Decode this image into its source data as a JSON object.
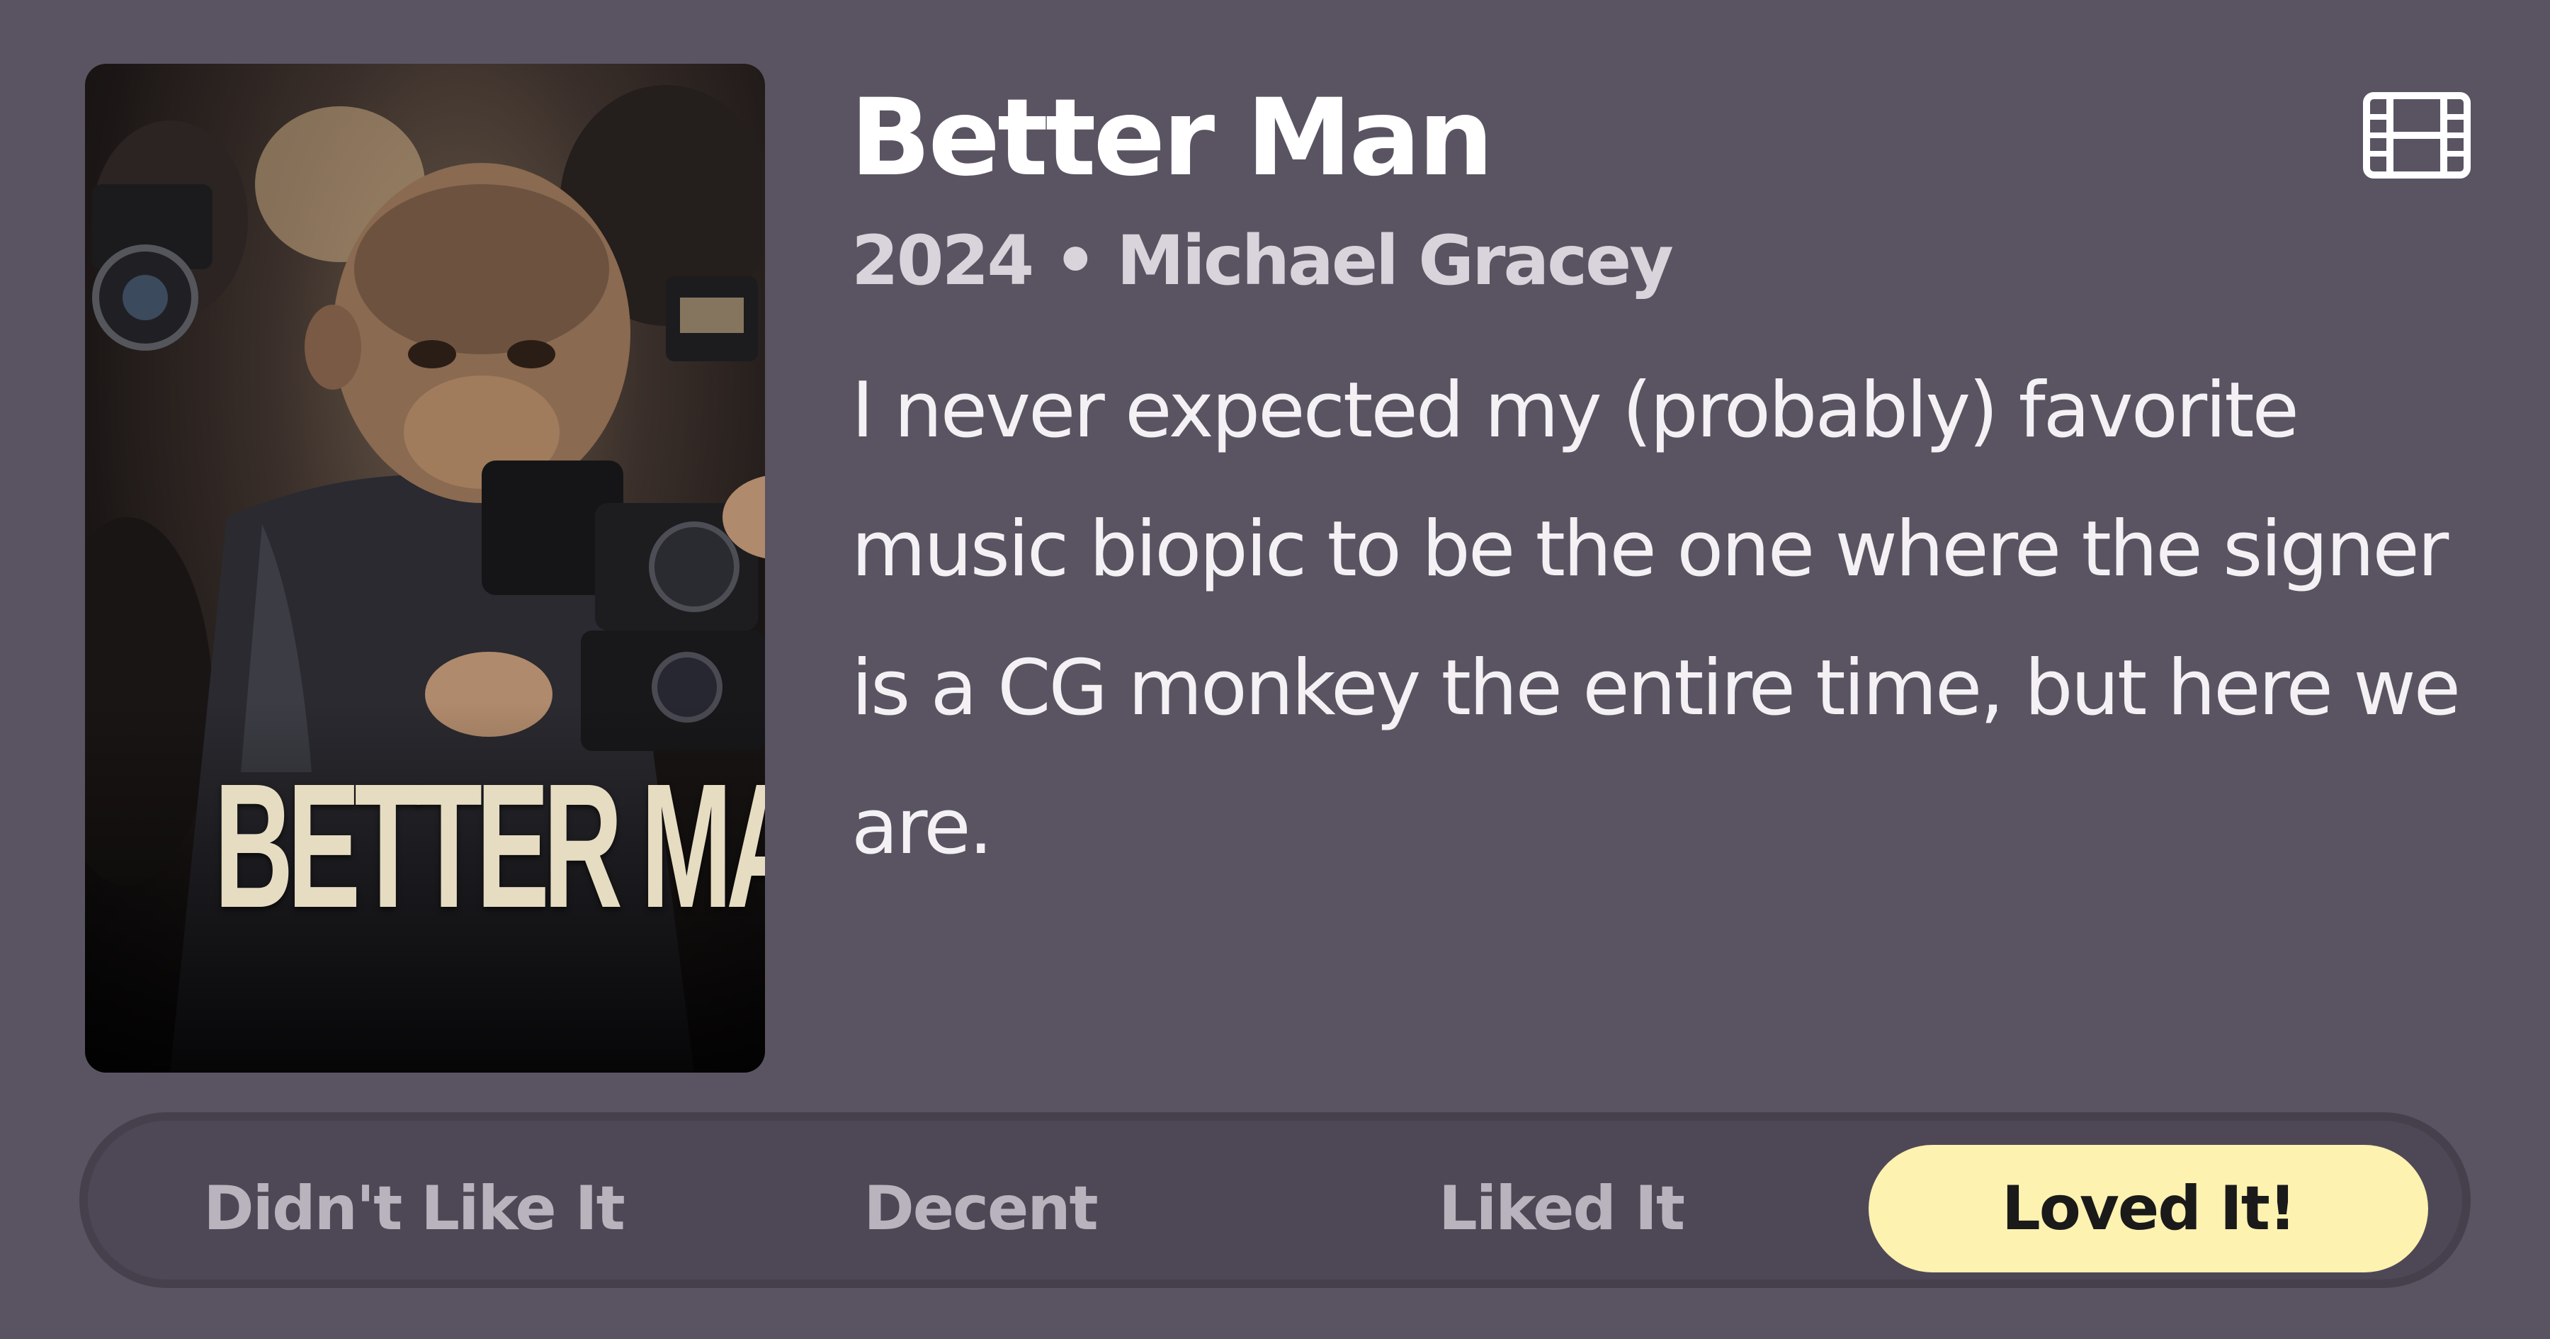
{
  "movie": {
    "title": "Better Man",
    "year": "2024",
    "separator": "•",
    "director": "Michael Gracey",
    "meta_line": "2024 • Michael Gracey",
    "review": "I never expected my (probably) favorite music biopic to be the one where the signer is a CG monkey the entire time, but here we are.",
    "poster_title": "BETTER MAN",
    "type_icon": "film-icon"
  },
  "rating": {
    "options": [
      {
        "label": "Didn't Like It",
        "selected": false
      },
      {
        "label": "Decent",
        "selected": false
      },
      {
        "label": "Liked It",
        "selected": false
      },
      {
        "label": "Loved It!",
        "selected": true
      }
    ]
  },
  "colors": {
    "background": "#5a5462",
    "selected_pill": "#fdf2b0",
    "unselected_text": "#b9b3bd",
    "title_text": "#ffffff"
  }
}
